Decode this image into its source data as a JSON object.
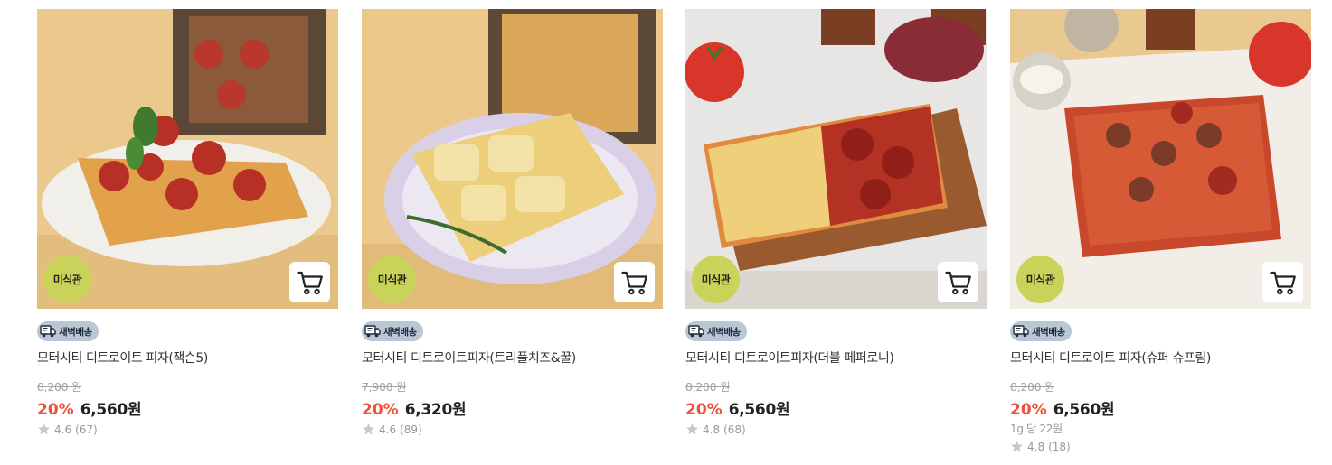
{
  "colors": {
    "badge_bg": "#c9d35a",
    "delivery_bg": "#b9c6d6",
    "discount": "#f0513a",
    "star": "#c8c8c8"
  },
  "products": [
    {
      "brand_badge": "미식관",
      "delivery_label": "새벽배송",
      "name": "모터시티 디트로이트 피자(잭슨5)",
      "original_price": "8,200 원",
      "discount": "20%",
      "price": "6,560원",
      "rating": "4.6",
      "reviews": "(67)",
      "cart_icon": "cart-icon"
    },
    {
      "brand_badge": "미식관",
      "delivery_label": "새벽배송",
      "name": "모터시티 디트로이트피자(트리플치즈&꿀)",
      "original_price": "7,900 원",
      "discount": "20%",
      "price": "6,320원",
      "rating": "4.6",
      "reviews": "(89)",
      "cart_icon": "cart-icon"
    },
    {
      "brand_badge": "미식관",
      "delivery_label": "새벽배송",
      "name": "모터시티 디트로이트피자(더블 페퍼로니)",
      "original_price": "8,200 원",
      "discount": "20%",
      "price": "6,560원",
      "rating": "4.8",
      "reviews": "(68)",
      "cart_icon": "cart-icon"
    },
    {
      "brand_badge": "미식관",
      "delivery_label": "새벽배송",
      "name": "모터시티 디트로이트 피자(슈퍼 슈프림)",
      "original_price": "8,200 원",
      "discount": "20%",
      "price": "6,560원",
      "unit_price": "1g 당 22원",
      "rating": "4.8",
      "reviews": "(18)",
      "cart_icon": "cart-icon"
    }
  ]
}
